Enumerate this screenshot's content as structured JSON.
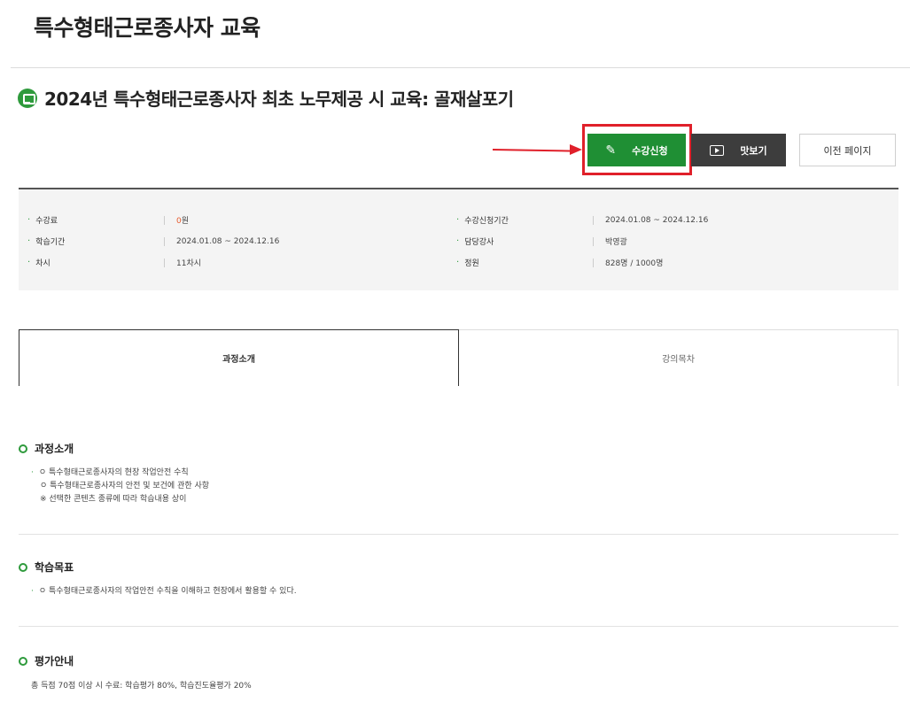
{
  "page": {
    "title": "특수형태근로종사자 교육"
  },
  "course": {
    "title": "2024년 특수형태근로종사자 최초 노무제공 시 교육: 골재살포기"
  },
  "buttons": {
    "apply": "수강신청",
    "preview": "맛보기",
    "back": "이전 페이지"
  },
  "info": {
    "fee_label": "수강료",
    "fee_value": "0",
    "fee_unit": "원",
    "apply_period_label": "수강신청기간",
    "apply_period_value": "2024.01.08 ~ 2024.12.16",
    "study_period_label": "학습기간",
    "study_period_value": "2024.01.08 ~ 2024.12.16",
    "instructor_label": "담당강사",
    "instructor_value": "박영광",
    "sessions_label": "차시",
    "sessions_value": "11차시",
    "capacity_label": "정원",
    "capacity_value": "828명 / 1000명"
  },
  "tabs": [
    {
      "label": "과정소개"
    },
    {
      "label": "강의목차"
    }
  ],
  "sections": {
    "intro": {
      "title": "과정소개",
      "lines": [
        "ㅇ 특수형태근로종사자의 현장 작업안전 수칙",
        "ㅇ 특수형태근로종사자의 안전 및 보건에 관한 사항",
        "※ 선택한 콘텐츠 종류에 따라 학습내용 상이"
      ]
    },
    "goal": {
      "title": "학습목표",
      "lines": [
        "ㅇ 특수형태근로종사자의 작업안전 수칙을 이해하고 현장에서 활용할 수 있다."
      ]
    },
    "eval": {
      "title": "평가안내",
      "text": "총 득점 70점 이상 시 수료: 학습평가 80%, 학습진도율평가 20%"
    }
  },
  "colors": {
    "accent_green": "#1f8f34",
    "highlight_red": "#e0202a",
    "dark_button": "#3d3d3d"
  }
}
